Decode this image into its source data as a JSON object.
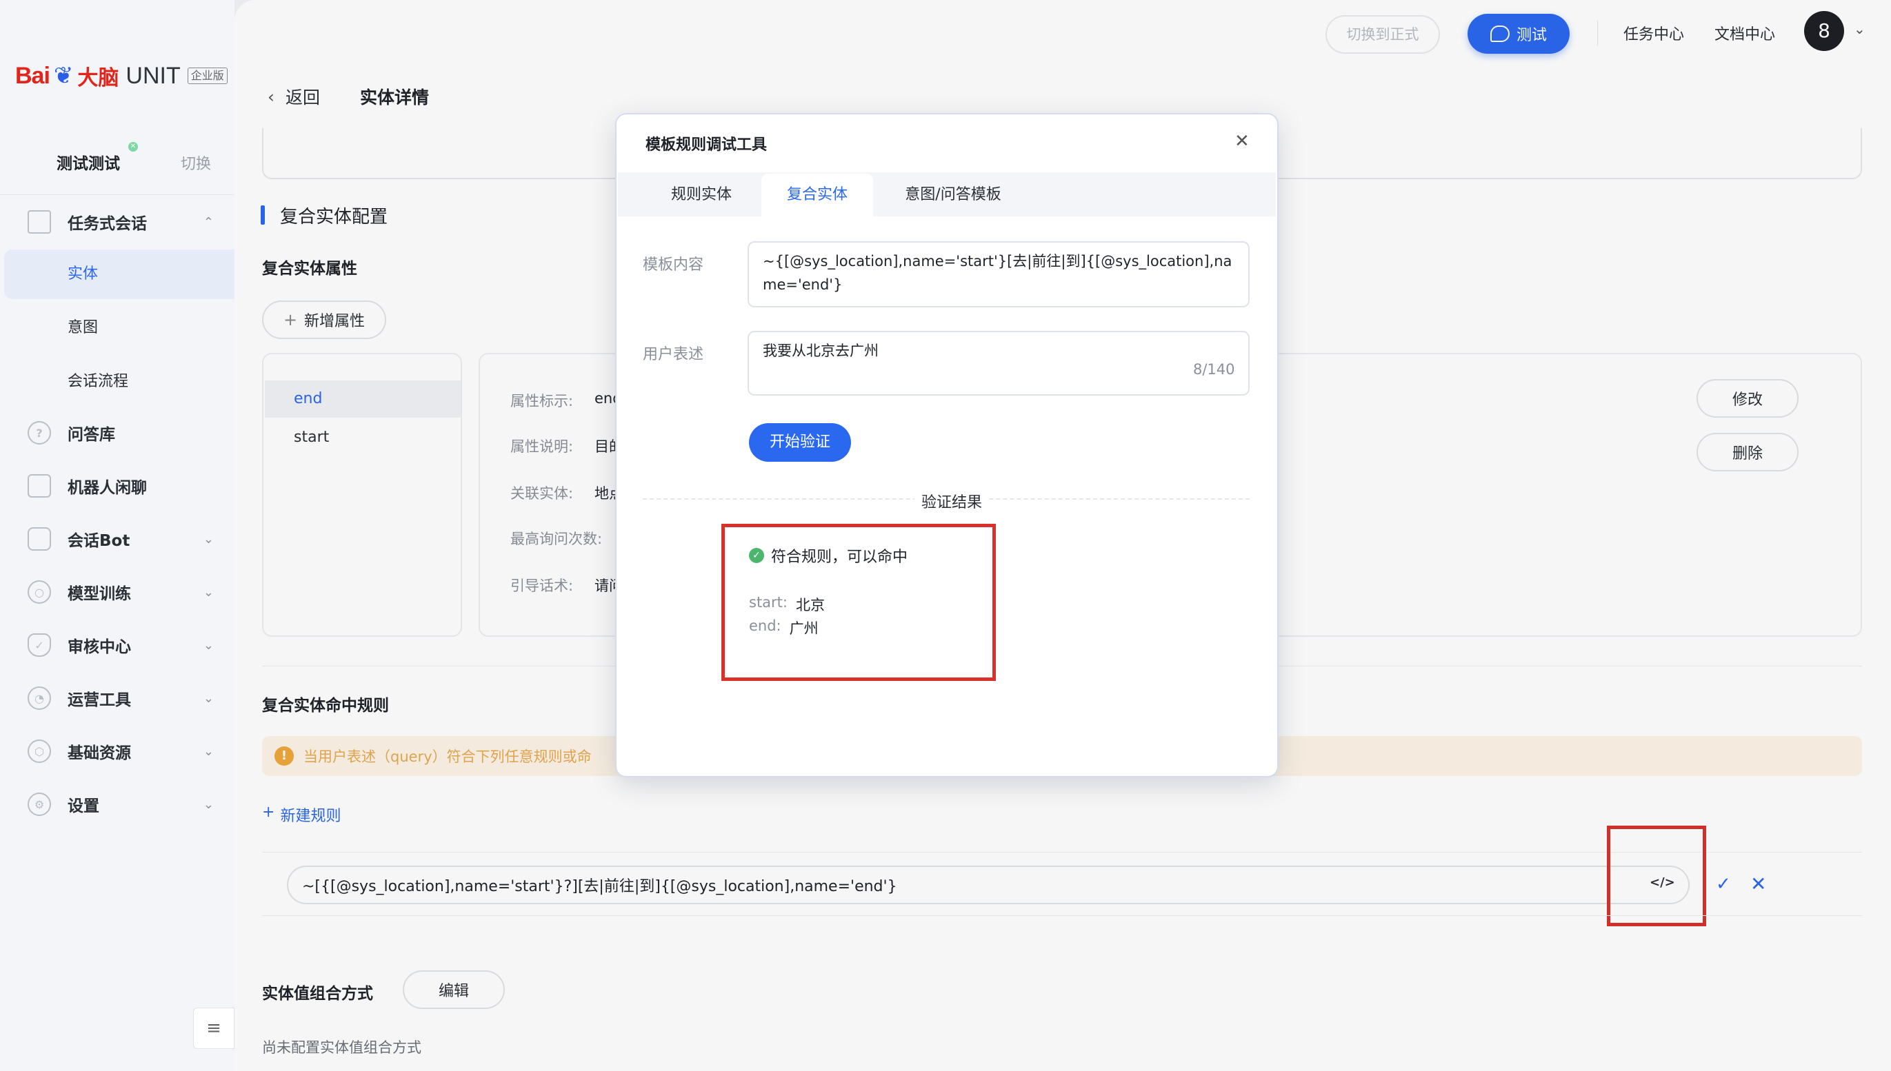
{
  "brand": {
    "bai": "Bai",
    "du": "du",
    "dn": "大脑",
    "unit": "UNIT",
    "edition": "企业版"
  },
  "workspace": {
    "name": "测试测试",
    "switch": "切换"
  },
  "sidebar": {
    "sections": [
      {
        "label": "任务式会话",
        "icon": "task-dialog-icon"
      },
      {
        "label": "问答库",
        "icon": "qa-icon"
      },
      {
        "label": "机器人闲聊",
        "icon": "chat-icon"
      },
      {
        "label": "会话Bot",
        "icon": "bot-icon"
      },
      {
        "label": "模型训练",
        "icon": "model-icon"
      },
      {
        "label": "审核中心",
        "icon": "review-icon"
      },
      {
        "label": "运营工具",
        "icon": "ops-icon"
      },
      {
        "label": "基础资源",
        "icon": "resource-icon"
      },
      {
        "label": "设置",
        "icon": "settings-icon"
      }
    ],
    "subitems": [
      "实体",
      "意图",
      "会话流程"
    ],
    "active": "实体"
  },
  "topbar": {
    "switch_prod": "切换到正式",
    "test": "测试",
    "task_center": "任务中心",
    "doc_center": "文档中心",
    "avatar": "8"
  },
  "page": {
    "back": "返回",
    "title": "实体详情"
  },
  "config": {
    "section_title": "复合实体配置",
    "attributes_title": "复合实体属性",
    "add_attribute": "新增属性",
    "attributes": [
      "end",
      "start"
    ],
    "detail_labels": [
      "属性标示:",
      "属性说明:",
      "关联实体:",
      "最高询问次数:",
      "引导话术:"
    ],
    "detail_values": [
      "end",
      "目的",
      "地点",
      "",
      "请问"
    ],
    "edit": "修改",
    "delete": "删除",
    "rules_title": "复合实体命中规则",
    "alert": "当用户表述（query）符合下列任意规则或命",
    "new_rule": "新建规则",
    "rule_value": "~[{[@sys_location],name='start'}?][去|前往|到]{[@sys_location],name='end'}",
    "combo_title": "实体值组合方式",
    "combo_edit": "编辑",
    "combo_empty": "尚未配置实体值组合方式"
  },
  "modal": {
    "title": "模板规则调试工具",
    "tabs": [
      "规则实体",
      "复合实体",
      "意图/问答模板"
    ],
    "active_tab": "复合实体",
    "template_label": "模板内容",
    "template_value": "~{[@sys_location],name='start'}[去|前往|到]{[@sys_location],name='end'}",
    "utterance_label": "用户表述",
    "utterance_value": "我要从北京去广州",
    "counter": "8/140",
    "verify": "开始验证",
    "result_title": "验证结果",
    "result_ok": "符合规则，可以命中",
    "result_rows": [
      {
        "k": "start:",
        "v": "北京"
      },
      {
        "k": "end:",
        "v": "广州"
      }
    ]
  },
  "colors": {
    "accent": "#2a68f0",
    "highlight": "#d9302b",
    "success": "#4cb56e",
    "warning": "#efa83b"
  }
}
